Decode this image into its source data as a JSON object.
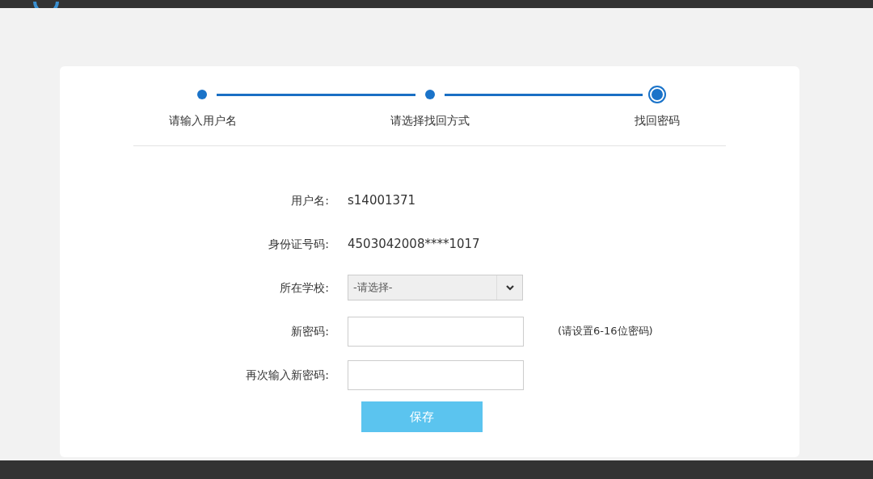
{
  "steps": [
    {
      "label": "请输入用户名",
      "current": false
    },
    {
      "label": "请选择找回方式",
      "current": false
    },
    {
      "label": "找回密码",
      "current": true
    }
  ],
  "form": [
    {
      "kind": "text",
      "label": "用户名:",
      "value": "s14001371"
    },
    {
      "kind": "text",
      "label": "身份证号码:",
      "value": "4503042008****1017"
    },
    {
      "kind": "select",
      "label": "所在学校:",
      "value": "-请选择-"
    },
    {
      "kind": "input",
      "label": "新密码:",
      "hint": "(请设置6-16位密码)"
    },
    {
      "kind": "input",
      "label": "再次输入新密码:"
    }
  ],
  "save_button": "保存"
}
